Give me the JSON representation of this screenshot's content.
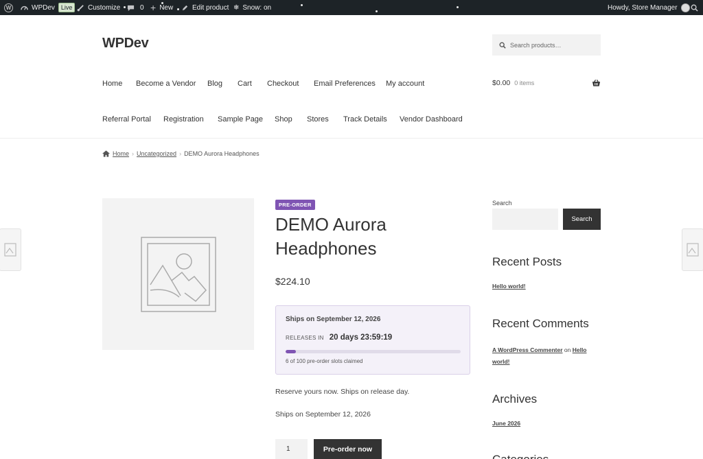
{
  "admin_bar": {
    "site_name": "WPDev",
    "live_badge": "Live",
    "customize": "Customize",
    "comments_count": "0",
    "new_label": "New",
    "edit_product": "Edit product",
    "snow_label": "Snow: on",
    "greeting": "Howdy, Store Manager"
  },
  "header": {
    "site_title": "WPDev",
    "search_placeholder": "Search products…",
    "nav_row1": [
      "Home",
      "Become a Vendor",
      "Blog",
      "Cart",
      "Checkout",
      "Email Preferences",
      "My account"
    ],
    "nav_row2": [
      "Referral Portal",
      "Registration",
      "Sample Page",
      "Shop",
      "Stores",
      "Track Details",
      "Vendor Dashboard"
    ],
    "cart_total": "$0.00",
    "cart_items": "0 items"
  },
  "breadcrumb": {
    "home": "Home",
    "category": "Uncategorized",
    "current": "DEMO Aurora Headphones"
  },
  "product": {
    "badge": "PRE-ORDER",
    "title": "DEMO Aurora Headphones",
    "price": "$224.10",
    "ships_heading": "Ships on September 12, 2026",
    "releases_label": "RELEASES IN",
    "countdown": "20 days 23:59:19",
    "slots_claimed": 6,
    "slots_total": 100,
    "slots_text": "6 of 100 pre-order slots claimed",
    "description": "Reserve yours now. Ships on release day.",
    "ships_note": "Ships on September 12, 2026",
    "quantity": "1",
    "button": "Pre-order now"
  },
  "sidebar": {
    "search_label": "Search",
    "search_button": "Search",
    "recent_posts_title": "Recent Posts",
    "recent_post": "Hello world!",
    "recent_comments_title": "Recent Comments",
    "comment_author": "A WordPress Commenter",
    "comment_on": "on",
    "comment_post": "Hello world!",
    "archives_title": "Archives",
    "archive_month": "June 2026",
    "categories_title": "Categories"
  },
  "colors": {
    "admin_bar": "#1d2327",
    "accent": "#7f54b3",
    "button": "#333333"
  }
}
